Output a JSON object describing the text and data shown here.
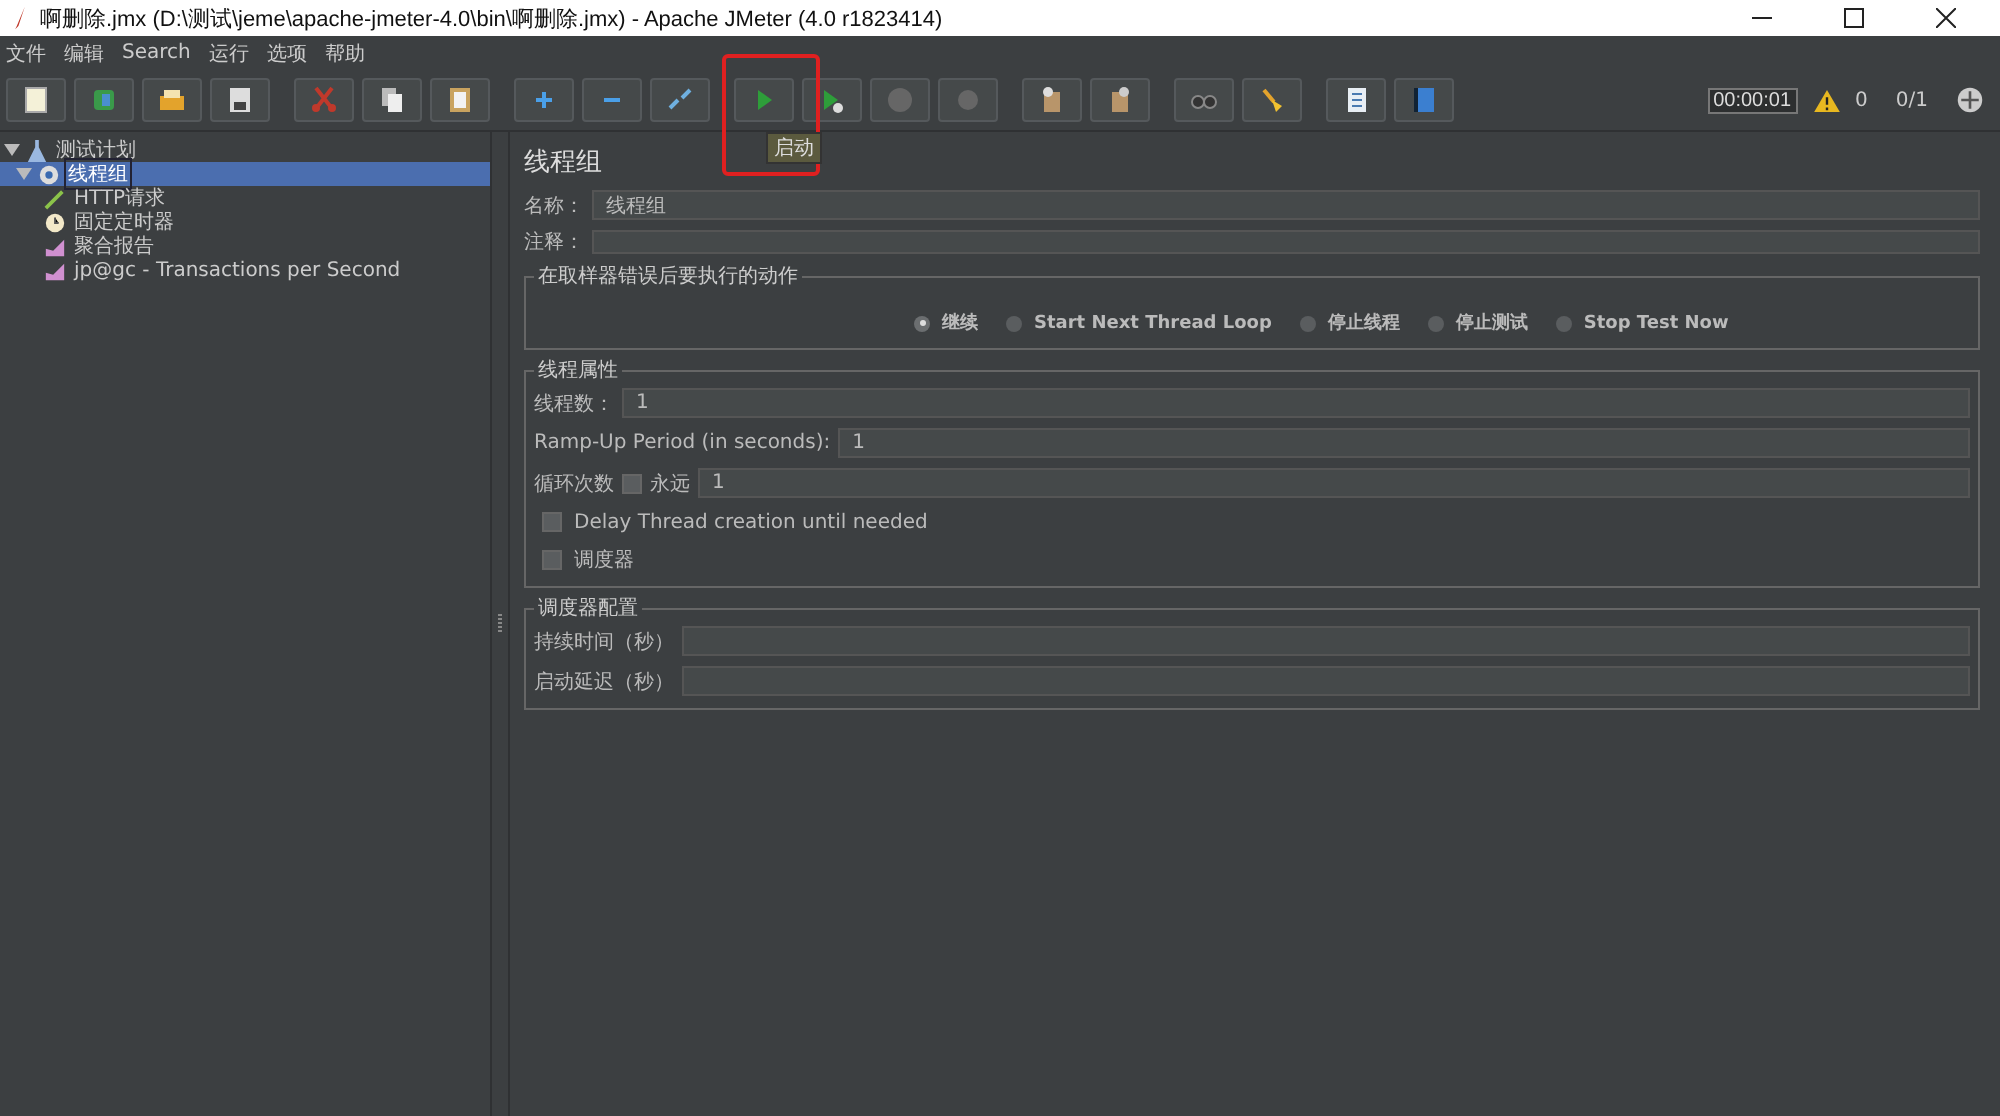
{
  "window": {
    "title": "啊删除.jmx (D:\\测试\\jeme\\apache-jmeter-4.0\\bin\\啊删除.jmx) - Apache JMeter (4.0 r1823414)"
  },
  "menu": [
    "文件",
    "编辑",
    "Search",
    "运行",
    "选项",
    "帮助"
  ],
  "toolbar": [
    {
      "kind": "new"
    },
    {
      "kind": "templates"
    },
    {
      "kind": "open"
    },
    {
      "kind": "save"
    },
    {
      "kind": "cut"
    },
    {
      "kind": "copy"
    },
    {
      "kind": "paste"
    },
    {
      "kind": "expand"
    },
    {
      "kind": "collapse"
    },
    {
      "kind": "toggle"
    },
    {
      "kind": "start"
    },
    {
      "kind": "start-nopause"
    },
    {
      "kind": "stop"
    },
    {
      "kind": "shutdown"
    },
    {
      "kind": "clear"
    },
    {
      "kind": "clear-all"
    },
    {
      "kind": "search"
    },
    {
      "kind": "reset-search"
    },
    {
      "kind": "function"
    },
    {
      "kind": "help"
    }
  ],
  "tooltip": "启动",
  "status": {
    "timer": "00:00:01",
    "warnings": "0",
    "threads": "0/1"
  },
  "tree": [
    {
      "label": "测试计划",
      "kind": "plan",
      "expanded": true,
      "selected": false,
      "children": [
        {
          "label": "线程组",
          "kind": "thread-group",
          "expanded": true,
          "selected": true,
          "children": [
            {
              "label": "HTTP请求",
              "kind": "sampler",
              "selected": false
            },
            {
              "label": "固定定时器",
              "kind": "timer",
              "selected": false
            },
            {
              "label": "聚合报告",
              "kind": "listener",
              "selected": false
            },
            {
              "label": "jp@gc - Transactions per Second",
              "kind": "listener",
              "selected": false
            }
          ]
        }
      ]
    }
  ],
  "panel": {
    "title": "线程组",
    "name": {
      "label": "名称：",
      "value": "线程组"
    },
    "comment": {
      "label": "注释："
    },
    "error_action": {
      "legend": "在取样器错误后要执行的动作",
      "options": [
        {
          "label": "继续",
          "selected": true
        },
        {
          "label": "Start Next Thread Loop",
          "selected": false
        },
        {
          "label": "停止线程",
          "selected": false
        },
        {
          "label": "停止测试",
          "selected": false
        },
        {
          "label": "Stop Test Now",
          "selected": false
        }
      ]
    },
    "thread_props": {
      "legend": "线程属性",
      "threads": {
        "label": "线程数：",
        "value": "1"
      },
      "rampup": {
        "label": "Ramp-Up Period (in seconds):",
        "value": "1"
      },
      "loop": {
        "label": "循环次数",
        "forever_label": "永远",
        "forever": false,
        "value": "1"
      },
      "delay": {
        "label": "Delay Thread creation until needed",
        "checked": false
      },
      "scheduler": {
        "label": "调度器",
        "checked": false
      }
    },
    "scheduler_config": {
      "legend": "调度器配置",
      "fields": [
        {
          "label": "持续时间（秒）"
        },
        {
          "label": "启动延迟（秒）"
        }
      ]
    }
  }
}
